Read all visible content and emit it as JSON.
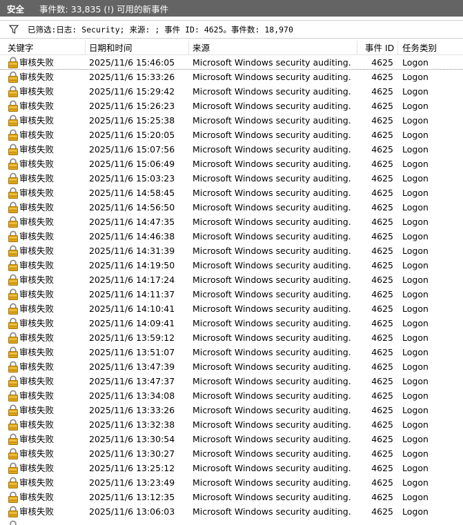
{
  "titlebar": {
    "title": "安全",
    "count_text": "事件数: 33,835 (!) 可用的新事件"
  },
  "filter": {
    "icon": "funnel-icon",
    "text": "已筛选:日志: Security; 来源: ; 事件 ID: 4625。事件数: 18,970"
  },
  "columns": {
    "keyword": "关键字",
    "datetime": "日期和时间",
    "source": "来源",
    "event_id": "事件 ID",
    "task": "任务类别"
  },
  "rows": [
    {
      "keyword": "审核失败",
      "datetime": "2025/11/6 15:46:05",
      "source": "Microsoft Windows security auditing.",
      "event_id": "4625",
      "task": "Logon"
    },
    {
      "keyword": "审核失败",
      "datetime": "2025/11/6 15:33:26",
      "source": "Microsoft Windows security auditing.",
      "event_id": "4625",
      "task": "Logon"
    },
    {
      "keyword": "审核失败",
      "datetime": "2025/11/6 15:29:42",
      "source": "Microsoft Windows security auditing.",
      "event_id": "4625",
      "task": "Logon"
    },
    {
      "keyword": "审核失败",
      "datetime": "2025/11/6 15:26:23",
      "source": "Microsoft Windows security auditing.",
      "event_id": "4625",
      "task": "Logon"
    },
    {
      "keyword": "审核失败",
      "datetime": "2025/11/6 15:25:38",
      "source": "Microsoft Windows security auditing.",
      "event_id": "4625",
      "task": "Logon"
    },
    {
      "keyword": "审核失败",
      "datetime": "2025/11/6 15:20:05",
      "source": "Microsoft Windows security auditing.",
      "event_id": "4625",
      "task": "Logon"
    },
    {
      "keyword": "审核失败",
      "datetime": "2025/11/6 15:07:56",
      "source": "Microsoft Windows security auditing.",
      "event_id": "4625",
      "task": "Logon"
    },
    {
      "keyword": "审核失败",
      "datetime": "2025/11/6 15:06:49",
      "source": "Microsoft Windows security auditing.",
      "event_id": "4625",
      "task": "Logon"
    },
    {
      "keyword": "审核失败",
      "datetime": "2025/11/6 15:03:23",
      "source": "Microsoft Windows security auditing.",
      "event_id": "4625",
      "task": "Logon"
    },
    {
      "keyword": "审核失败",
      "datetime": "2025/11/6 14:58:45",
      "source": "Microsoft Windows security auditing.",
      "event_id": "4625",
      "task": "Logon"
    },
    {
      "keyword": "审核失败",
      "datetime": "2025/11/6 14:56:50",
      "source": "Microsoft Windows security auditing.",
      "event_id": "4625",
      "task": "Logon"
    },
    {
      "keyword": "审核失败",
      "datetime": "2025/11/6 14:47:35",
      "source": "Microsoft Windows security auditing.",
      "event_id": "4625",
      "task": "Logon"
    },
    {
      "keyword": "审核失败",
      "datetime": "2025/11/6 14:46:38",
      "source": "Microsoft Windows security auditing.",
      "event_id": "4625",
      "task": "Logon"
    },
    {
      "keyword": "审核失败",
      "datetime": "2025/11/6 14:31:39",
      "source": "Microsoft Windows security auditing.",
      "event_id": "4625",
      "task": "Logon"
    },
    {
      "keyword": "审核失败",
      "datetime": "2025/11/6 14:19:50",
      "source": "Microsoft Windows security auditing.",
      "event_id": "4625",
      "task": "Logon"
    },
    {
      "keyword": "审核失败",
      "datetime": "2025/11/6 14:17:24",
      "source": "Microsoft Windows security auditing.",
      "event_id": "4625",
      "task": "Logon"
    },
    {
      "keyword": "审核失败",
      "datetime": "2025/11/6 14:11:37",
      "source": "Microsoft Windows security auditing.",
      "event_id": "4625",
      "task": "Logon"
    },
    {
      "keyword": "审核失败",
      "datetime": "2025/11/6 14:10:41",
      "source": "Microsoft Windows security auditing.",
      "event_id": "4625",
      "task": "Logon"
    },
    {
      "keyword": "审核失败",
      "datetime": "2025/11/6 14:09:41",
      "source": "Microsoft Windows security auditing.",
      "event_id": "4625",
      "task": "Logon"
    },
    {
      "keyword": "审核失败",
      "datetime": "2025/11/6 13:59:12",
      "source": "Microsoft Windows security auditing.",
      "event_id": "4625",
      "task": "Logon"
    },
    {
      "keyword": "审核失败",
      "datetime": "2025/11/6 13:51:07",
      "source": "Microsoft Windows security auditing.",
      "event_id": "4625",
      "task": "Logon"
    },
    {
      "keyword": "审核失败",
      "datetime": "2025/11/6 13:47:39",
      "source": "Microsoft Windows security auditing.",
      "event_id": "4625",
      "task": "Logon"
    },
    {
      "keyword": "审核失败",
      "datetime": "2025/11/6 13:47:37",
      "source": "Microsoft Windows security auditing.",
      "event_id": "4625",
      "task": "Logon"
    },
    {
      "keyword": "审核失败",
      "datetime": "2025/11/6 13:34:08",
      "source": "Microsoft Windows security auditing.",
      "event_id": "4625",
      "task": "Logon"
    },
    {
      "keyword": "审核失败",
      "datetime": "2025/11/6 13:33:26",
      "source": "Microsoft Windows security auditing.",
      "event_id": "4625",
      "task": "Logon"
    },
    {
      "keyword": "审核失败",
      "datetime": "2025/11/6 13:32:38",
      "source": "Microsoft Windows security auditing.",
      "event_id": "4625",
      "task": "Logon"
    },
    {
      "keyword": "审核失败",
      "datetime": "2025/11/6 13:30:54",
      "source": "Microsoft Windows security auditing.",
      "event_id": "4625",
      "task": "Logon"
    },
    {
      "keyword": "审核失败",
      "datetime": "2025/11/6 13:30:27",
      "source": "Microsoft Windows security auditing.",
      "event_id": "4625",
      "task": "Logon"
    },
    {
      "keyword": "审核失败",
      "datetime": "2025/11/6 13:25:12",
      "source": "Microsoft Windows security auditing.",
      "event_id": "4625",
      "task": "Logon"
    },
    {
      "keyword": "审核失败",
      "datetime": "2025/11/6 13:23:49",
      "source": "Microsoft Windows security auditing.",
      "event_id": "4625",
      "task": "Logon"
    },
    {
      "keyword": "审核失败",
      "datetime": "2025/11/6 13:12:35",
      "source": "Microsoft Windows security auditing.",
      "event_id": "4625",
      "task": "Logon"
    },
    {
      "keyword": "审核失败",
      "datetime": "2025/11/6 13:06:03",
      "source": "Microsoft Windows security auditing.",
      "event_id": "4625",
      "task": "Logon"
    }
  ],
  "row_icon": "lock-icon",
  "colors": {
    "titlebar_bg": "#646464",
    "lock_gold": "#e0a81e"
  }
}
